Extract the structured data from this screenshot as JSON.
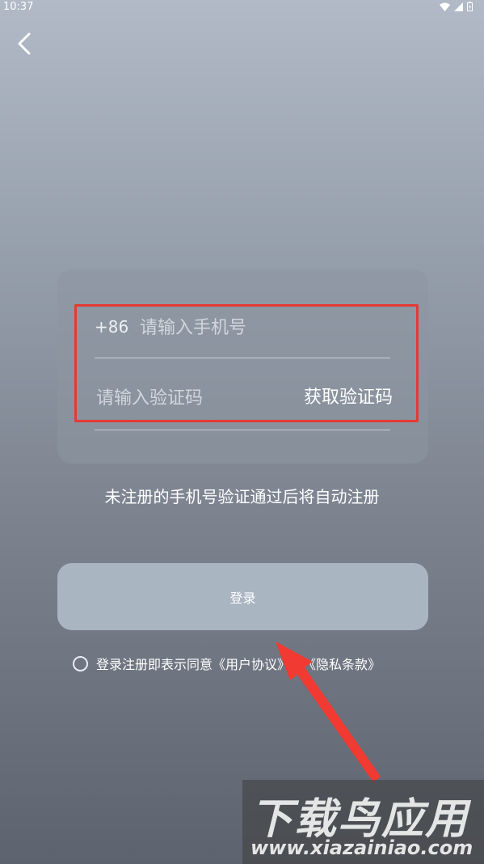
{
  "status_bar": {
    "time": "10:37",
    "icons": [
      "wifi-icon",
      "signal-icon",
      "battery-icon"
    ]
  },
  "nav": {
    "back_icon": "chevron-left-icon"
  },
  "form": {
    "country_code": "+86",
    "phone_placeholder": "请输入手机号",
    "code_placeholder": "请输入验证码",
    "get_code_label": "获取验证码"
  },
  "hint": "未注册的手机号验证通过后将自动注册",
  "login_label": "登录",
  "agreement": {
    "text": "登录注册即表示同意《用户协议》和《隐私条款》",
    "checked": false
  },
  "watermark": {
    "title": "下载鸟应用",
    "url": "www.xiazainiao.com"
  },
  "colors": {
    "highlight": "#e53935",
    "button": "#aab5c2"
  }
}
